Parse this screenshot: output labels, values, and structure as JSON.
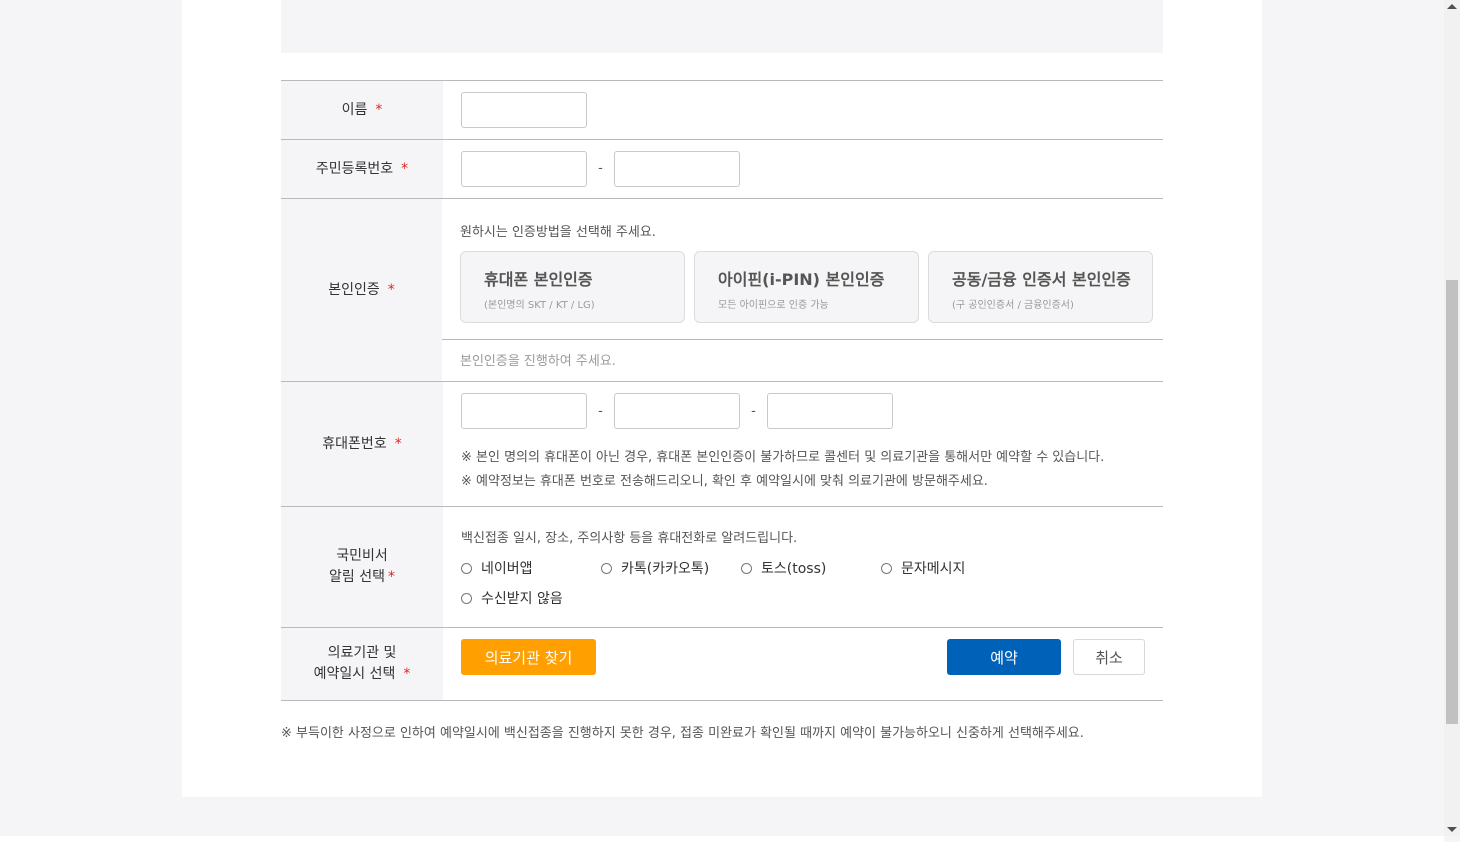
{
  "form": {
    "name": {
      "label": "이름",
      "required_mark": "*",
      "value": ""
    },
    "rrn": {
      "label": "주민등록번호",
      "required_mark": "*",
      "first": "",
      "second": "",
      "separator": "-"
    },
    "auth": {
      "label": "본인인증",
      "required_mark": "*",
      "guide": "원하시는 인증방법을 선택해 주세요.",
      "methods": [
        {
          "title": "휴대폰 본인인증",
          "sub": "(본인명의 SKT / KT / LG)"
        },
        {
          "title": "아이핀(i-PIN) 본인인증",
          "sub": "모든 아이핀으로 인증 가능"
        },
        {
          "title": "공동/금융 인증서 본인인증",
          "sub": "(구 공인인증서 / 금융인증서)"
        }
      ],
      "status": "본인인증을 진행하여 주세요."
    },
    "phone": {
      "label": "휴대폰번호",
      "required_mark": "*",
      "separator": "-",
      "parts": [
        "",
        "",
        ""
      ],
      "notes": [
        "※ 본인 명의의 휴대폰이 아닌 경우, 휴대폰 본인인증이 불가하므로 콜센터 및 의료기관을 통해서만 예약할 수 있습니다.",
        "※ 예약정보는 휴대폰 번호로 전송해드리오니, 확인 후 예약일시에 맞춰 의료기관에 방문해주세요."
      ]
    },
    "alarm": {
      "label_line1": "국민비서",
      "label_line2": "알림 선택",
      "required_mark": "*",
      "guide": "백신접종 일시, 장소, 주의사항 등을 휴대전화로 알려드립니다.",
      "options": [
        "네이버앱",
        "카톡(카카오톡)",
        "토스(toss)",
        "문자메시지",
        "수신받지 않음"
      ]
    },
    "clinic": {
      "label_line1": "의료기관 및",
      "label_line2": "예약일시 선택",
      "required_mark": "*",
      "find_button": "의료기관 찾기",
      "reserve_button": "예약",
      "cancel_button": "취소"
    }
  },
  "footnote": "※ 부득이한 사정으로 인하여 예약일시에 백신접종을 진행하지 못한 경우, 접종 미완료가 확인될 때까지 예약이 불가능하오니 신중하게 선택해주세요.",
  "colors": {
    "accent_orange": "#ff9f00",
    "primary_blue": "#0061b8",
    "required_red": "#e0241e",
    "label_bg": "#f5f5f7"
  }
}
